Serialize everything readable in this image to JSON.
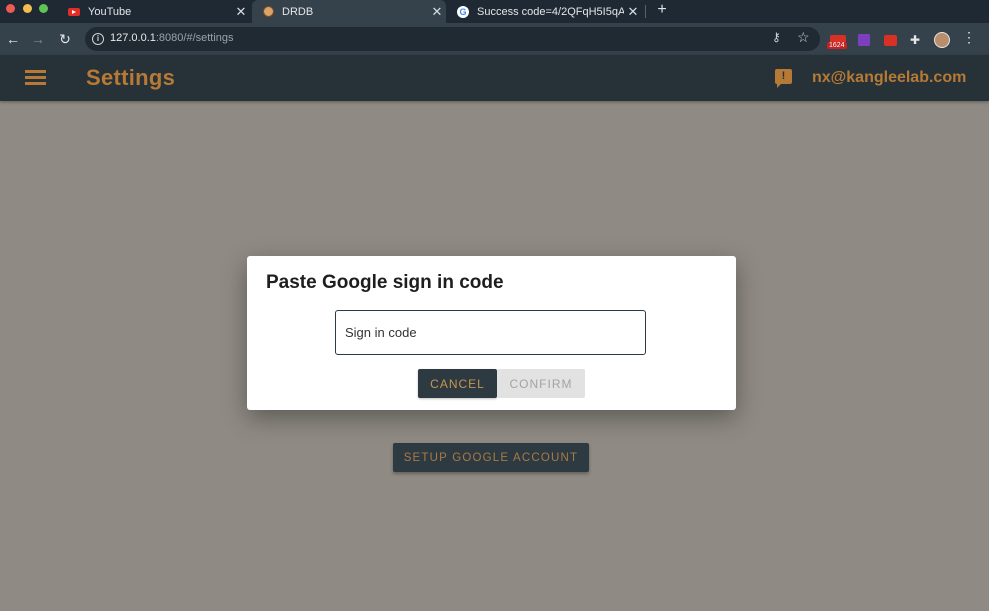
{
  "browser": {
    "tabs": [
      {
        "title": "YouTube",
        "icon": "youtube-icon"
      },
      {
        "title": "DRDB",
        "icon": "drdb-icon"
      },
      {
        "title": "Success code=4/2QFqH5I5qA",
        "icon": "google-icon"
      }
    ],
    "new_tab_label": "+",
    "url_host": "127.0.0.1",
    "url_rest": ":8080/#/settings",
    "extension_badge": "1624"
  },
  "app": {
    "title": "Settings",
    "user_email": "nx@kangleelab.com",
    "accent_color": "#b67a36",
    "header_color": "#273138"
  },
  "main": {
    "setup_button_label": "SETUP GOOGLE ACCOUNT"
  },
  "dialog": {
    "title": "Paste Google sign in code",
    "input_placeholder": "Sign in code",
    "input_value": "",
    "cancel_label": "CANCEL",
    "confirm_label": "CONFIRM"
  }
}
